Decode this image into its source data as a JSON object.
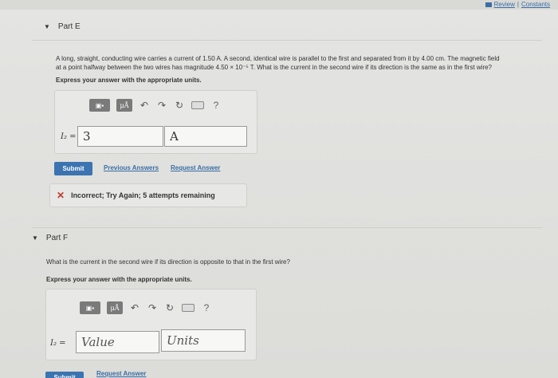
{
  "header": {
    "review_label": "Review",
    "separator": "|",
    "constants_label": "Constants"
  },
  "partE": {
    "title": "Part E",
    "question_line1": "A long, straight, conducting wire carries a current of 1.50 A. A second, identical wire is parallel to the first and separated from it by 4.00 cm. The magnetic field",
    "question_line2": "at a point halfway between the two wires has magnitude 4.50 × 10⁻⁵ T. What is the current in the second wire if its direction is the same as in the first wire?",
    "express": "Express your answer with the appropriate units.",
    "variable": "I₂ =",
    "value": "3",
    "units": "A",
    "submit_label": "Submit",
    "previous_answers_label": "Previous Answers",
    "request_answer_label": "Request Answer",
    "feedback": "Incorrect; Try Again; 5 attempts remaining"
  },
  "partF": {
    "title": "Part F",
    "question": "What is the current in the second wire if its direction is opposite to that in the first wire?",
    "express": "Express your answer with the appropriate units.",
    "variable": "I₂ =",
    "value_placeholder": "Value",
    "units_placeholder": "Units",
    "submit_label": "Submit",
    "request_answer_label": "Request Answer"
  },
  "toolbar": {
    "mu_label": "μÅ",
    "help_label": "?"
  }
}
